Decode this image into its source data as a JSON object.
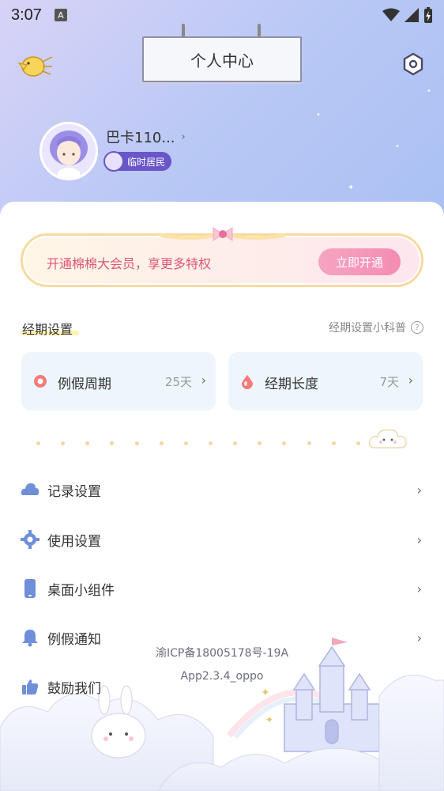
{
  "status_bar": {
    "time": "3:07",
    "badge_letter": "A"
  },
  "header": {
    "title": "个人中心"
  },
  "profile": {
    "username": "巴卡110...",
    "chevron": "›",
    "badge": "临时居民"
  },
  "vip_banner": {
    "text": "开通棉棉大会员，享更多特权",
    "button": "立即开通"
  },
  "period_settings": {
    "title": "经期设置",
    "help_label": "经期设置小科普",
    "help_icon_glyph": "?",
    "tiles": [
      {
        "label": "例假周期",
        "value": "25天",
        "chevron": "›"
      },
      {
        "label": "经期长度",
        "value": "7天",
        "chevron": "›"
      }
    ]
  },
  "menu": [
    {
      "label": "记录设置",
      "icon": "cloud-bell-icon",
      "chevron": "›"
    },
    {
      "label": "使用设置",
      "icon": "gear-icon",
      "chevron": "›"
    },
    {
      "label": "桌面小组件",
      "icon": "phone-icon",
      "chevron": "›"
    },
    {
      "label": "例假通知",
      "icon": "bell-icon",
      "chevron": "›"
    },
    {
      "label": "鼓励我们",
      "icon": "thumbs-up-icon",
      "chevron": "›"
    }
  ],
  "footer": {
    "icp": "渝ICP备18005178号-19A",
    "version": "App2.3.4_oppo"
  },
  "colors": {
    "accent_pink": "#f48cb2",
    "badge_purple": "#6957c7",
    "tile_bg": "#eef6fc",
    "menu_icon": "#6f8fd8"
  }
}
